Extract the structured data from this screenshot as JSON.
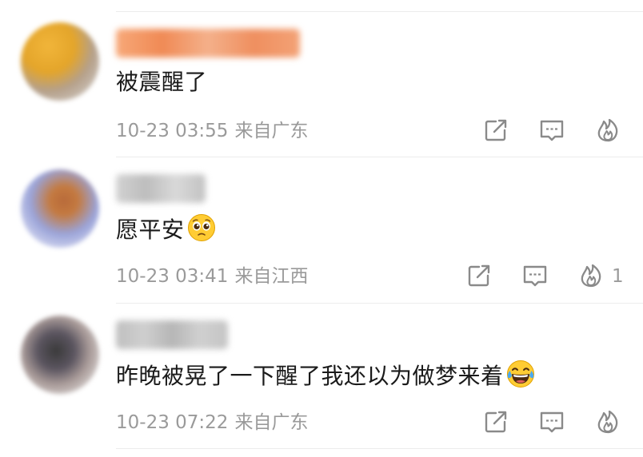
{
  "comments": [
    {
      "text": "被震醒了",
      "date": "10-23 03:55",
      "location": "来自广东",
      "likes": "",
      "emoji": "",
      "avatar_colors": [
        "#e4a52a",
        "#7e6a5a"
      ],
      "username_color": "#f08a55"
    },
    {
      "text": "愿平安",
      "date": "10-23 03:41",
      "location": "来自江西",
      "likes": "1",
      "emoji": "pleading-face",
      "avatar_colors": [
        "#9aa3d8",
        "#b86a3a"
      ],
      "username_color": "#c4c4c4"
    },
    {
      "text": "昨晚被晃了一下醒了我还以为做梦来着",
      "date": "10-23 07:22",
      "location": "来自广东",
      "likes": "",
      "emoji": "tears-of-joy",
      "avatar_colors": [
        "#3a3a3a",
        "#c9c2c0"
      ],
      "username_color": "#b8b8b8"
    }
  ],
  "icons": {
    "share": "share-icon",
    "reply": "comment-icon",
    "like": "flame-icon"
  }
}
